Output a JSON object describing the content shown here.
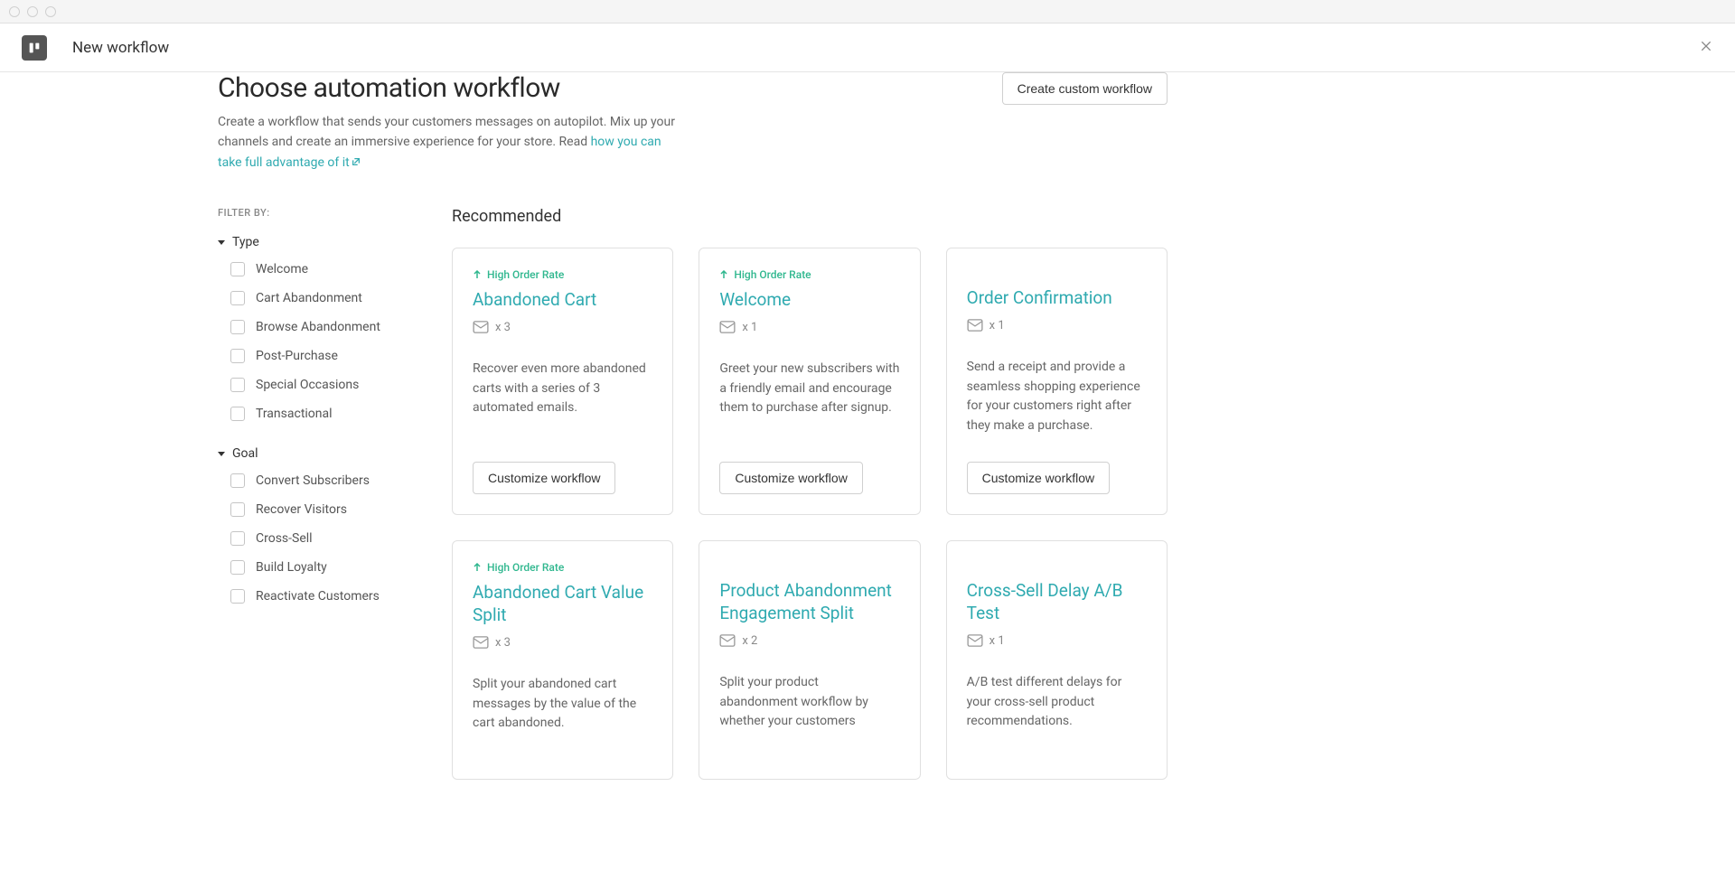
{
  "header": {
    "title": "New workflow"
  },
  "page": {
    "title": "Choose automation workflow",
    "create_custom_label": "Create custom workflow",
    "description_pre": "Create a workflow that sends your customers messages on autopilot. Mix up your channels and create an immersive experience for your store. Read ",
    "description_link": "how you can take full advantage of it"
  },
  "sidebar": {
    "filter_by_label": "FILTER BY:",
    "groups": [
      {
        "title": "Type",
        "items": [
          {
            "label": "Welcome"
          },
          {
            "label": "Cart Abandonment"
          },
          {
            "label": "Browse Abandonment"
          },
          {
            "label": "Post-Purchase"
          },
          {
            "label": "Special Occasions"
          },
          {
            "label": "Transactional"
          }
        ]
      },
      {
        "title": "Goal",
        "items": [
          {
            "label": "Convert Subscribers"
          },
          {
            "label": "Recover Visitors"
          },
          {
            "label": "Cross-Sell"
          },
          {
            "label": "Build Loyalty"
          },
          {
            "label": "Reactivate Customers"
          }
        ]
      }
    ]
  },
  "recommended": {
    "section_title": "Recommended",
    "badge_label": "High Order Rate",
    "customize_label": "Customize workflow",
    "cards": [
      {
        "has_badge": true,
        "title": "Abandoned Cart",
        "count": "x 3",
        "description": "Recover even more abandoned carts with a series of 3 automated emails.",
        "has_button": true
      },
      {
        "has_badge": true,
        "title": "Welcome",
        "count": "x 1",
        "description": "Greet your new subscribers with a friendly email and encourage them to purchase after signup.",
        "has_button": true
      },
      {
        "has_badge": false,
        "title": "Order Confirmation",
        "count": "x 1",
        "description": "Send a receipt and provide a seamless shopping experience for your customers right after they make a purchase.",
        "has_button": true
      },
      {
        "has_badge": true,
        "title": "Abandoned Cart Value Split",
        "count": "x 3",
        "description": "Split your abandoned cart messages by the value of the cart abandoned.",
        "has_button": false
      },
      {
        "has_badge": false,
        "title": "Product Abandonment Engagement Split",
        "count": "x 2",
        "description": "Split your product abandonment workflow by whether your customers",
        "has_button": false
      },
      {
        "has_badge": false,
        "title": "Cross-Sell Delay A/B Test",
        "count": "x 1",
        "description": "A/B test different delays for your cross-sell product recommendations.",
        "has_button": false
      }
    ]
  }
}
